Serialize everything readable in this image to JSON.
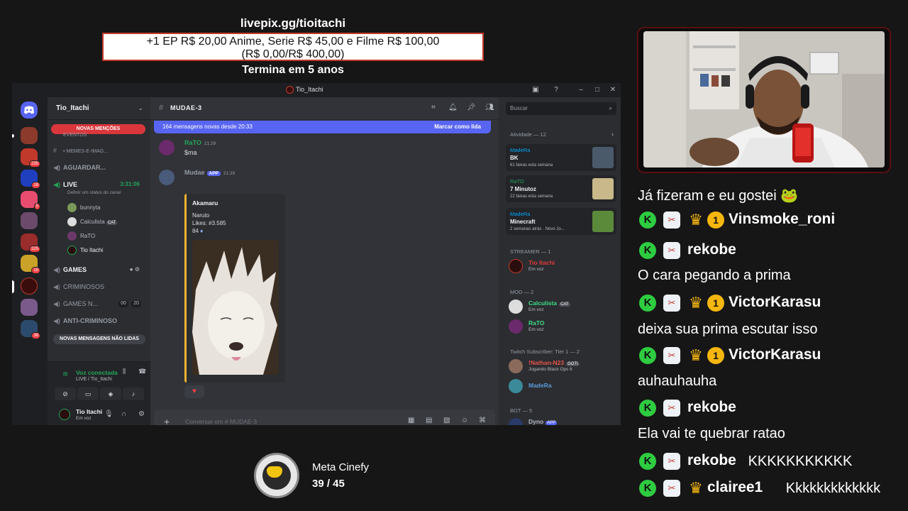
{
  "overlay": {
    "url": "livepix.gg/tioitachi",
    "goal_line1": "+1 EP R$ 20,00 Anime, Serie R$ 45,00 e Filme R$ 100,00",
    "goal_line2": "(R$ 0,00/R$ 400,00)",
    "ends": "Termina em 5 anos"
  },
  "discord": {
    "window_title": "Tio_Itachi",
    "server_name": "Tio_Itachi",
    "server_badges": [
      "235",
      "18",
      "5",
      "225",
      "16",
      "16",
      "38"
    ],
    "mentions_pill": "NOVAS MENÇÕES",
    "unread_pill": "NOVAS MENSAGENS NÃO LIDAS",
    "channels": {
      "events": "EVENTOS",
      "memes": "• MEMES-E-IMAG...",
      "aguardar": "AGUARDAR...",
      "live": "LIVE",
      "live_time": "3:31:06",
      "live_status": "Definir um status do canal",
      "games": "GAMES",
      "criminosos": "CRIMINOSOS",
      "games_n": "GAMES N...",
      "games_n_tag1": "00",
      "games_n_tag2": "20",
      "anti": "ANTI-CRIMINOSO"
    },
    "voice_users": [
      {
        "name": "bunnyta"
      },
      {
        "name": "Calculista",
        "tag": "CAT"
      },
      {
        "name": "RaTO"
      },
      {
        "name": "Tio Itachi"
      }
    ],
    "voice_panel": {
      "title": "Voz conectada",
      "sub": "LIVE / Tio_Itachi"
    },
    "user_panel": {
      "name": "Tio Itachi",
      "status": "Em voz"
    },
    "channel_header": "MUDAE-3",
    "search_placeholder": "Buscar",
    "newbar": {
      "text": "164 mensagens novas desde 20:33",
      "action": "Marcar como lida"
    },
    "messages": [
      {
        "author": "RaTO",
        "time": "21:29",
        "text": "$ma"
      },
      {
        "author": "Mudae",
        "badge": "APP",
        "time": "21:29"
      }
    ],
    "embed": {
      "title": "Akamaru",
      "series": "Naruto",
      "likes": "Likes: #3.585",
      "value": "84"
    },
    "composer_placeholder": "Conversar em #",
    "composer_channel": "MUDAE-3",
    "activity_header": "Atividade — 12",
    "activity_cards": [
      {
        "user": "MadeRa",
        "title": "BK",
        "sub": "61 faixas esta semana"
      },
      {
        "user": "RaTO",
        "title": "7 Minutoz",
        "sub": "22 faixas esta semana"
      },
      {
        "user": "MadeRa",
        "title": "Minecraft",
        "sub": "2 semanas atrás · Novo Jo..."
      }
    ],
    "groups": {
      "streamer": "STREAMER — 1",
      "mod": "MOD — 2",
      "subs": "Twitch Subscriber: Tier 1 — 2",
      "bot": "BOT — 5"
    },
    "members": {
      "streamer": {
        "name": "Tio Itachi",
        "status": "Em voz"
      },
      "mod1": {
        "name": "Calculista",
        "tag": "CAT",
        "status": "Em voz"
      },
      "mod2": {
        "name": "RaTO",
        "status": "Em voz"
      },
      "sub1": {
        "name": "!Nathan-N23",
        "tag": "GOTI",
        "status": "Jogando Black Ops 6"
      },
      "sub2": {
        "name": "MadeRa"
      },
      "bot1": {
        "name": "Dyno",
        "tag": "APP"
      }
    }
  },
  "goal": {
    "name": "Meta Cinefy",
    "value": "39 / 45"
  },
  "chat": [
    {
      "type": "text",
      "text": "Já fizeram e eu gostei 🐸"
    },
    {
      "type": "user",
      "user": "Vinsmoke_roni",
      "crown": true,
      "sub": "1",
      "text": ""
    },
    {
      "type": "user",
      "user": "rekobe",
      "crown": false,
      "text": ""
    },
    {
      "type": "text",
      "text": "O cara pegando a prima"
    },
    {
      "type": "user",
      "user": "VictorKarasu",
      "crown": true,
      "sub": "1",
      "text": ""
    },
    {
      "type": "text",
      "text": "deixa sua prima escutar isso"
    },
    {
      "type": "user",
      "user": "VictorKarasu",
      "crown": true,
      "sub": "1",
      "text": ""
    },
    {
      "type": "text",
      "text": "auhauhauha"
    },
    {
      "type": "user",
      "user": "rekobe",
      "crown": false,
      "text": ""
    },
    {
      "type": "text",
      "text": "Ela vai te quebrar ratao"
    },
    {
      "type": "user",
      "user": "rekobe",
      "crown": false,
      "text": "KKKKKKKKKKK"
    },
    {
      "type": "user",
      "user": "clairee1",
      "crown": true,
      "text": "Kkkkkkkkkkkkk"
    }
  ],
  "colors": {
    "discord_bg": "#313338",
    "discord_sidebar": "#2b2d31",
    "blurple": "#5865f2",
    "green": "#23a559",
    "red": "#da373c",
    "chat_badge_green": "#2ecc40",
    "crown": "#f5b70f"
  }
}
